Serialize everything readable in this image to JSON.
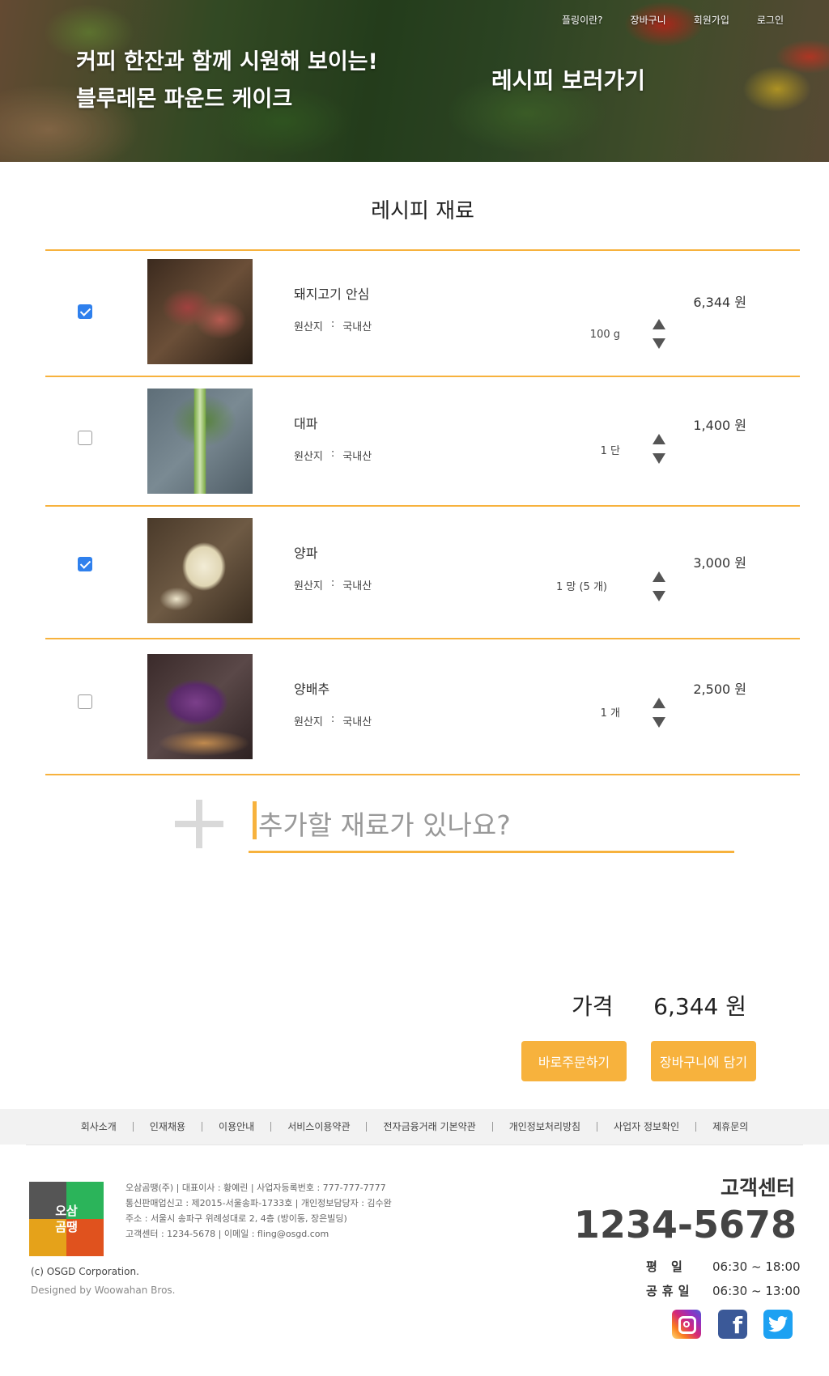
{
  "hero": {
    "line1": "커피 한잔과 함께 시원해 보이는!",
    "line2": "블루레몬 파운드 케이크",
    "cta": "레시피 보러가기"
  },
  "nav": {
    "about": "플링이란?",
    "cart": "장바구니",
    "signup": "회원가입",
    "login": "로그인"
  },
  "section_title": "레시피 재료",
  "origin_label": "원산지",
  "origin_sep": ":",
  "items": [
    {
      "checked": true,
      "name": "돼지고기 안심",
      "origin": "국내산",
      "qty": "100 g",
      "price": "6,344 원"
    },
    {
      "checked": false,
      "name": "대파",
      "origin": "국내산",
      "qty": "1 단",
      "price": "1,400 원"
    },
    {
      "checked": true,
      "name": "양파",
      "origin": "국내산",
      "qty": "1 망 (5 개)",
      "price": "3,000 원"
    },
    {
      "checked": false,
      "name": "양배추",
      "origin": "국내산",
      "qty": "1 개",
      "price": "2,500 원"
    }
  ],
  "add_ingredient": {
    "placeholder": "추가할 재료가 있나요?"
  },
  "total": {
    "label": "가격",
    "value": "6,344 원"
  },
  "buttons": {
    "order": "바로주문하기",
    "cart": "장바구니에 담기"
  },
  "footer_nav": [
    "회사소개",
    "인재채용",
    "이용안내",
    "서비스이용약관",
    "전자금융거래 기본약관",
    "개인정보처리방침",
    "사업자 정보확인",
    "제휴문의"
  ],
  "logo": {
    "line1": "오삼",
    "line2": "곰땡"
  },
  "company_info": [
    "오삼곰땡(주) | 대표이사 : 황예린 | 사업자등록번호 : 777-777-7777",
    "통신판매업신고 : 제2015-서울송파-1733호 | 개인정보담당자 : 김수완",
    "주소 : 서울시 송파구 위례성대로 2, 4층 (방이동, 장은빌딩)",
    "고객센터 : 1234-5678 | 이메일 : fling@osgd.com"
  ],
  "copyright": "(c) OSGD Corporation.",
  "designed_by": "Designed by Woowahan Bros.",
  "customer_center": {
    "title": "고객센터",
    "phone": "1234-5678",
    "weekday_label": "평 일",
    "weekday_hours": "06:30 ~ 18:00",
    "holiday_label": "공휴일",
    "holiday_hours": "06:30 ~ 13:00"
  },
  "social": [
    "instagram-icon",
    "facebook-icon",
    "twitter-icon"
  ],
  "colors": {
    "accent": "#f7b23d",
    "checkbox": "#2f80ed"
  }
}
